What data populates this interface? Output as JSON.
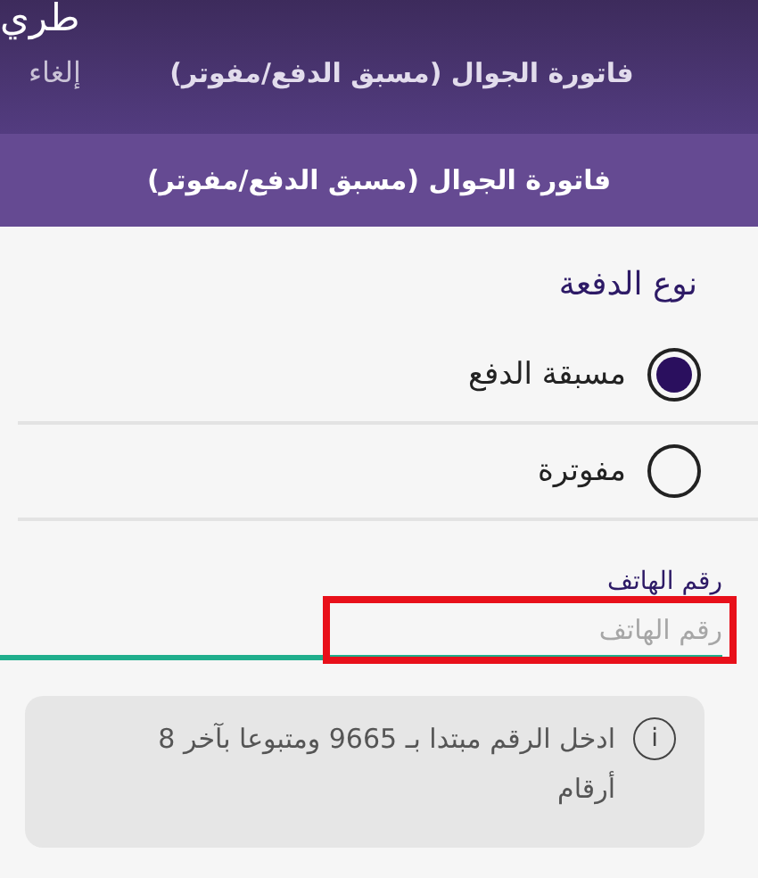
{
  "status_fragment": "طري",
  "header": {
    "title": "فاتورة الجوال (مسبق الدفع/مفوتر)",
    "cancel": "إلغاء"
  },
  "subheader": {
    "title": "فاتورة الجوال (مسبق الدفع/مفوتر)"
  },
  "payment_type": {
    "label": "نوع الدفعة",
    "options": [
      {
        "label": "مسبقة الدفع",
        "selected": true
      },
      {
        "label": "مفوترة",
        "selected": false
      }
    ]
  },
  "phone": {
    "label": "رقم الهاتف",
    "placeholder": "رقم الهاتف",
    "highlighted": true
  },
  "note": {
    "icon": "i",
    "text": "ادخل الرقم مبتدا بـ 9665 ومتبوعا بآخر 8 أرقام"
  }
}
